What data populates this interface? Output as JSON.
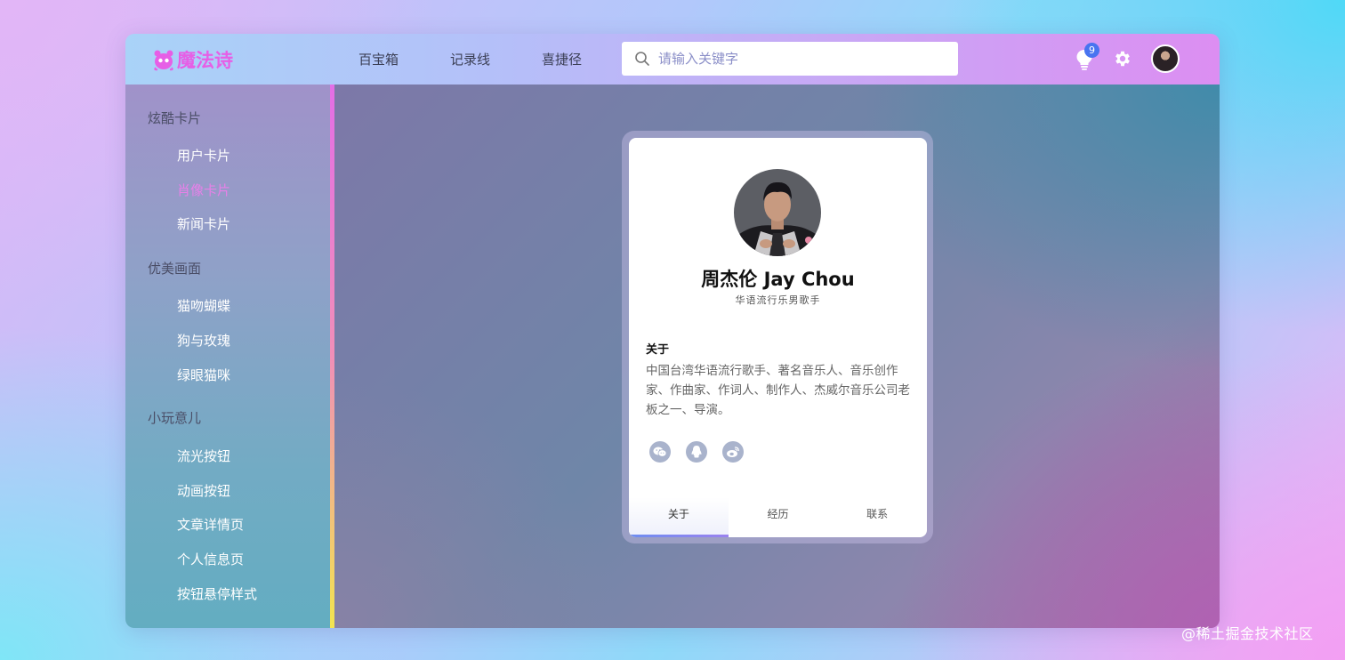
{
  "header": {
    "logo_text": "魔法诗",
    "nav": [
      "百宝箱",
      "记录线",
      "喜捷径"
    ],
    "search_placeholder": "请输入关键字",
    "notification_count": "9"
  },
  "sidebar": {
    "groups": [
      {
        "title": "炫酷卡片",
        "items": [
          "用户卡片",
          "肖像卡片",
          "新闻卡片"
        ]
      },
      {
        "title": "优美画面",
        "items": [
          "猫吻蝴蝶",
          "狗与玫瑰",
          "绿眼猫咪"
        ]
      },
      {
        "title": "小玩意儿",
        "items": [
          "流光按钮",
          "动画按钮",
          "文章详情页",
          "个人信息页",
          "按钮悬停样式"
        ]
      }
    ],
    "active_item": "肖像卡片"
  },
  "card": {
    "name": "周杰伦 Jay Chou",
    "subtitle": "华语流行乐男歌手",
    "about_heading": "关于",
    "about_text": "中国台湾华语流行歌手、著名音乐人、音乐创作家、作曲家、作词人、制作人、杰威尔音乐公司老板之一、导演。",
    "social_icons": [
      "wechat-icon",
      "qq-icon",
      "weibo-icon"
    ],
    "tabs": [
      "关于",
      "经历",
      "联系"
    ],
    "active_tab": "关于"
  },
  "watermark": "@稀土掘金技术社区",
  "colors": {
    "accent_pink": "#e65fe6",
    "active_sidebar": "#e880e8",
    "badge_blue": "#4874f0"
  }
}
